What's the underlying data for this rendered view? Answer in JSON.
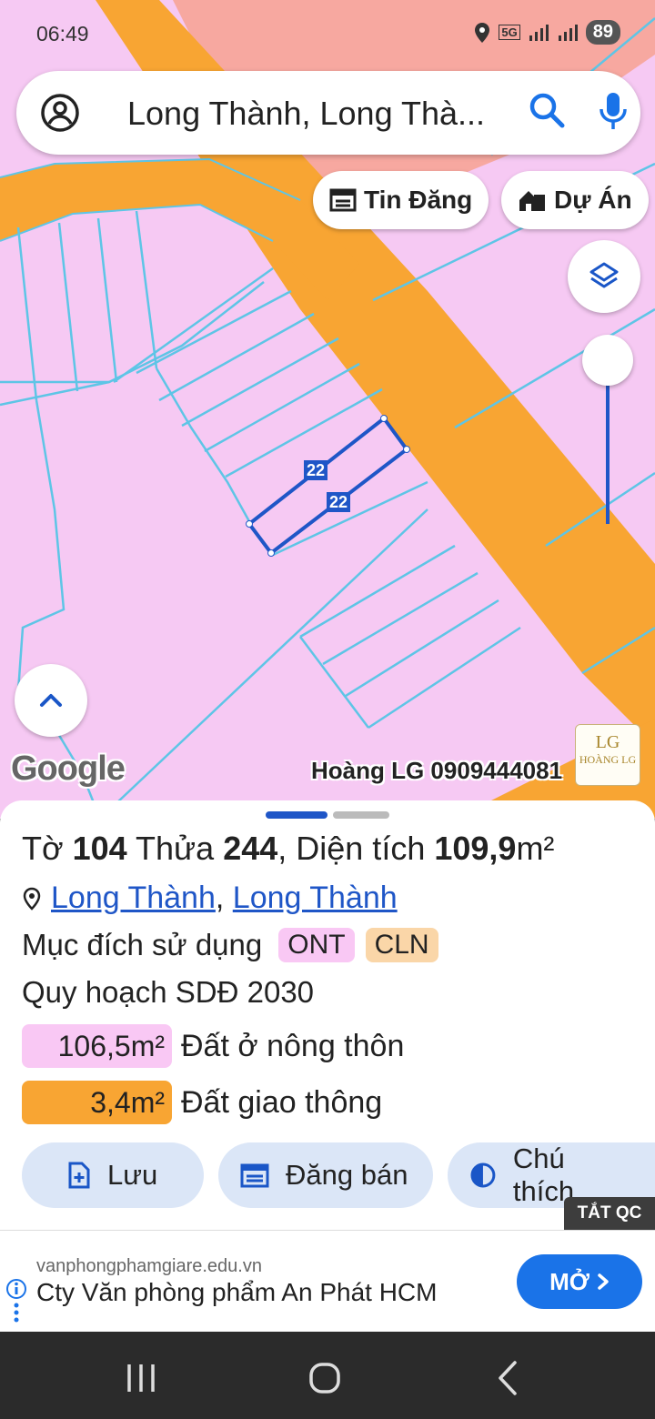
{
  "status_bar": {
    "time": "06:49",
    "network": "5G",
    "battery": "89"
  },
  "search": {
    "query": "Long Thành, Long Thà..."
  },
  "chips": {
    "listings": "Tin Đăng",
    "projects": "Dự Án"
  },
  "map": {
    "plot_labels": [
      "22",
      "22"
    ],
    "google": "Google",
    "watermark": "Hoàng LG 0909444081",
    "logo_mark": "LG",
    "logo_name": "HOÀNG LG",
    "colors": {
      "residential": "#f6c9f3",
      "road": "#f8a533",
      "parcel_line": "#5ec5e6",
      "selection": "#1f56c7"
    }
  },
  "panel": {
    "title_prefix": "Tờ ",
    "sheet_no": "104",
    "title_mid": " Thửa ",
    "parcel_no": "244",
    "title_area_label": ", Diện tích ",
    "area": "109,9",
    "area_unit": "m²",
    "location_1": "Long Thành",
    "location_sep": ",",
    "location_2": "Long Thành",
    "purpose_label": "Mục đích sử dụng",
    "purpose_tags": [
      "ONT",
      "CLN"
    ],
    "plan_label": "Quy hoạch SDĐ 2030",
    "zones": [
      {
        "area": "106,5m²",
        "label": "Đất ở nông thôn"
      },
      {
        "area": "3,4m²",
        "label": "Đất giao thông"
      }
    ],
    "buttons": {
      "save": "Lưu",
      "post": "Đăng bán",
      "legend": "Chú thích"
    }
  },
  "ad": {
    "close_label": "TẮT QC",
    "url": "vanphongphamgiare.edu.vn",
    "headline": "Cty Văn phòng phẩm An Phát HCM",
    "cta": "MỞ"
  }
}
